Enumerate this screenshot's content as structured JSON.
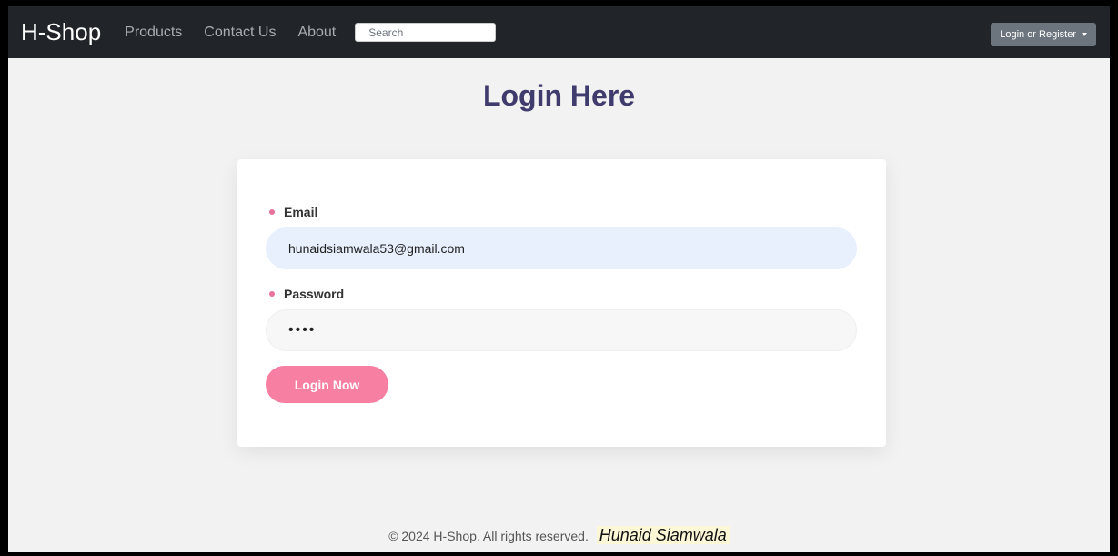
{
  "navbar": {
    "brand": "H-Shop",
    "links": [
      "Products",
      "Contact Us",
      "About"
    ],
    "search_placeholder": "Search",
    "login_label": "Login or Register"
  },
  "page": {
    "title": "Login Here"
  },
  "form": {
    "email_label": "Email",
    "email_value": "hunaidsiamwala53@gmail.com",
    "password_label": "Password",
    "password_value": "••••",
    "submit_label": "Login Now"
  },
  "footer": {
    "copyright": "© 2024 H-Shop. All rights reserved.",
    "signature": "Hunaid Siamwala"
  },
  "colors": {
    "navbar_bg": "#212529",
    "title": "#3f3b6c",
    "accent_pink": "#f67fa2",
    "email_field_bg": "#e8f0fe"
  }
}
